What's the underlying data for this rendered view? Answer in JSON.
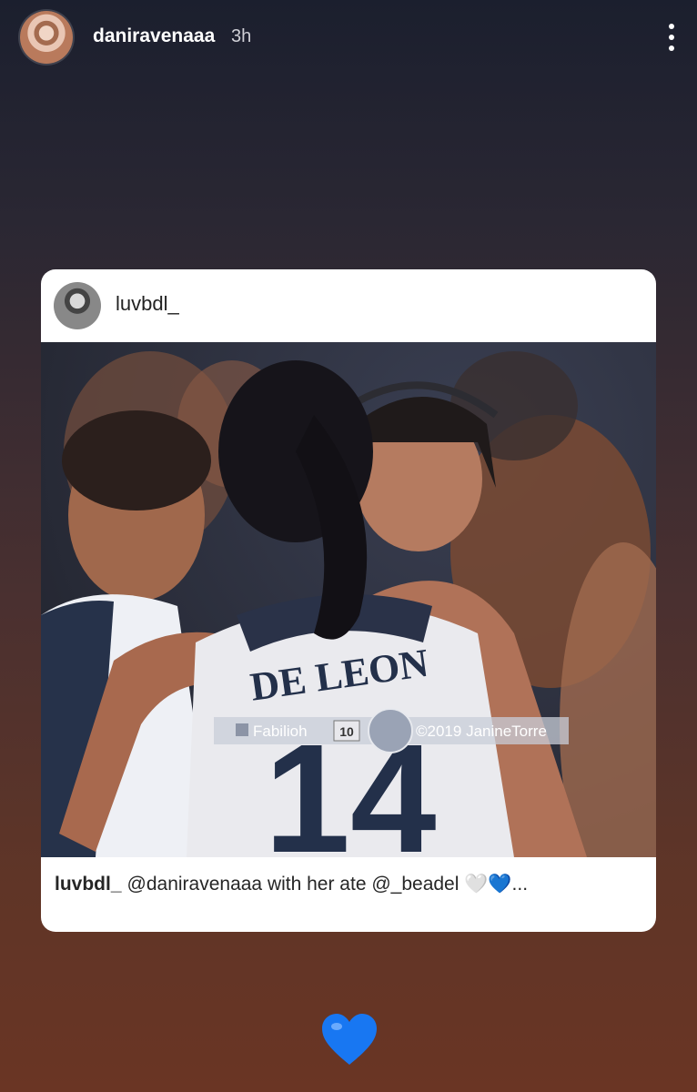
{
  "header": {
    "username": "daniravenaaa",
    "time": "3h",
    "more_icon": "more-vertical-icon"
  },
  "post": {
    "username": "luvbdl_",
    "photo": {
      "jersey_name": "DE LEON",
      "jersey_number": "14",
      "watermark_left": "Fabilioh",
      "watermark_badge": "10",
      "watermark_right": "©2019 JanineTorre"
    },
    "caption": {
      "username": "luvbdl_",
      "text": "@daniravenaaa with her ate @_beadel 🤍💙..."
    }
  },
  "reaction": {
    "icon": "blue-heart-icon",
    "color": "#1877f2"
  }
}
